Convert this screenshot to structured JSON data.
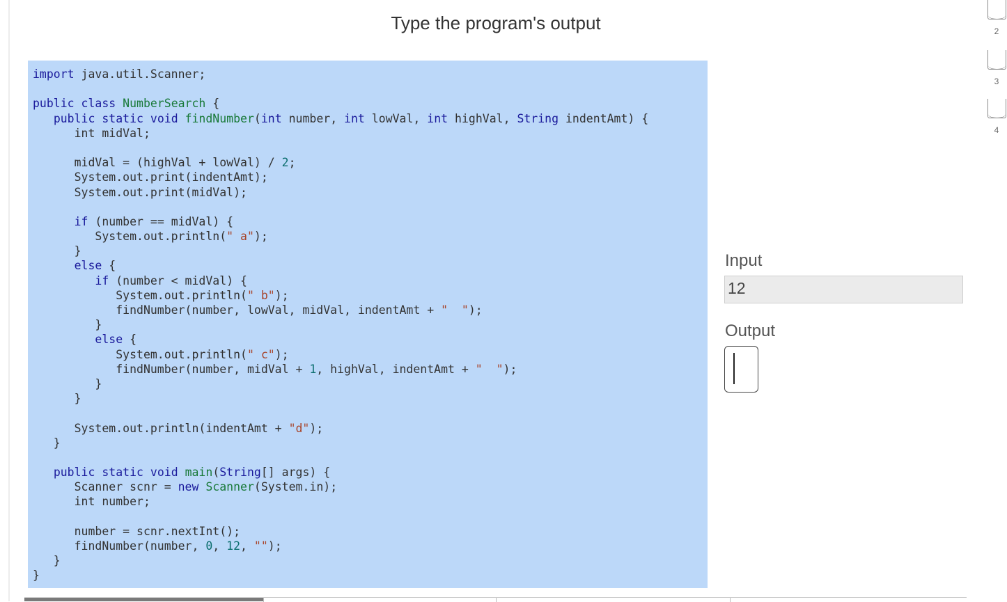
{
  "page": {
    "title": "Type the program's output"
  },
  "code": {
    "lines": [
      [
        {
          "t": "kw",
          "v": "import"
        },
        {
          "t": "",
          "v": " java.util.Scanner;"
        }
      ],
      [],
      [
        {
          "t": "kw",
          "v": "public class"
        },
        {
          "t": "",
          "v": " "
        },
        {
          "t": "cls",
          "v": "NumberSearch"
        },
        {
          "t": "",
          "v": " {"
        }
      ],
      [
        {
          "t": "",
          "v": "   "
        },
        {
          "t": "kw",
          "v": "public static void"
        },
        {
          "t": "",
          "v": " "
        },
        {
          "t": "fn",
          "v": "findNumber"
        },
        {
          "t": "",
          "v": "("
        },
        {
          "t": "kw",
          "v": "int"
        },
        {
          "t": "",
          "v": " number, "
        },
        {
          "t": "kw",
          "v": "int"
        },
        {
          "t": "",
          "v": " lowVal, "
        },
        {
          "t": "kw",
          "v": "int"
        },
        {
          "t": "",
          "v": " highVal, "
        },
        {
          "t": "kw",
          "v": "String"
        },
        {
          "t": "",
          "v": " indentAmt) {"
        }
      ],
      [
        {
          "t": "",
          "v": "      int midVal;"
        }
      ],
      [],
      [
        {
          "t": "",
          "v": "      midVal = (highVal + lowVal) / "
        },
        {
          "t": "num",
          "v": "2"
        },
        {
          "t": "",
          "v": ";"
        }
      ],
      [
        {
          "t": "",
          "v": "      System.out.print(indentAmt);"
        }
      ],
      [
        {
          "t": "",
          "v": "      System.out.print(midVal);"
        }
      ],
      [],
      [
        {
          "t": "",
          "v": "      "
        },
        {
          "t": "kw",
          "v": "if"
        },
        {
          "t": "",
          "v": " (number == midVal) {"
        }
      ],
      [
        {
          "t": "",
          "v": "         System.out.println("
        },
        {
          "t": "str",
          "v": "\" a\""
        },
        {
          "t": "",
          "v": ");"
        }
      ],
      [
        {
          "t": "",
          "v": "      }"
        }
      ],
      [
        {
          "t": "",
          "v": "      "
        },
        {
          "t": "kw",
          "v": "else"
        },
        {
          "t": "",
          "v": " {"
        }
      ],
      [
        {
          "t": "",
          "v": "         "
        },
        {
          "t": "kw",
          "v": "if"
        },
        {
          "t": "",
          "v": " (number < midVal) {"
        }
      ],
      [
        {
          "t": "",
          "v": "            System.out.println("
        },
        {
          "t": "str",
          "v": "\" b\""
        },
        {
          "t": "",
          "v": ");"
        }
      ],
      [
        {
          "t": "",
          "v": "            findNumber(number, lowVal, midVal, indentAmt + "
        },
        {
          "t": "str",
          "v": "\"  \""
        },
        {
          "t": "",
          "v": ");"
        }
      ],
      [
        {
          "t": "",
          "v": "         }"
        }
      ],
      [
        {
          "t": "",
          "v": "         "
        },
        {
          "t": "kw",
          "v": "else"
        },
        {
          "t": "",
          "v": " {"
        }
      ],
      [
        {
          "t": "",
          "v": "            System.out.println("
        },
        {
          "t": "str",
          "v": "\" c\""
        },
        {
          "t": "",
          "v": ");"
        }
      ],
      [
        {
          "t": "",
          "v": "            findNumber(number, midVal + "
        },
        {
          "t": "num",
          "v": "1"
        },
        {
          "t": "",
          "v": ", highVal, indentAmt + "
        },
        {
          "t": "str",
          "v": "\"  \""
        },
        {
          "t": "",
          "v": ");"
        }
      ],
      [
        {
          "t": "",
          "v": "         }"
        }
      ],
      [
        {
          "t": "",
          "v": "      }"
        }
      ],
      [],
      [
        {
          "t": "",
          "v": "      System.out.println(indentAmt + "
        },
        {
          "t": "str",
          "v": "\"d\""
        },
        {
          "t": "",
          "v": ");"
        }
      ],
      [
        {
          "t": "",
          "v": "   }"
        }
      ],
      [],
      [
        {
          "t": "",
          "v": "   "
        },
        {
          "t": "kw",
          "v": "public static void"
        },
        {
          "t": "",
          "v": " "
        },
        {
          "t": "fn",
          "v": "main"
        },
        {
          "t": "",
          "v": "("
        },
        {
          "t": "kw",
          "v": "String"
        },
        {
          "t": "",
          "v": "[] args) {"
        }
      ],
      [
        {
          "t": "",
          "v": "      Scanner scnr = "
        },
        {
          "t": "kw",
          "v": "new"
        },
        {
          "t": "",
          "v": " "
        },
        {
          "t": "cls",
          "v": "Scanner"
        },
        {
          "t": "",
          "v": "(System.in);"
        }
      ],
      [
        {
          "t": "",
          "v": "      int number;"
        }
      ],
      [],
      [
        {
          "t": "",
          "v": "      number = scnr.nextInt();"
        }
      ],
      [
        {
          "t": "",
          "v": "      findNumber(number, "
        },
        {
          "t": "num",
          "v": "0"
        },
        {
          "t": "",
          "v": ", "
        },
        {
          "t": "num",
          "v": "12"
        },
        {
          "t": "",
          "v": ", "
        },
        {
          "t": "str",
          "v": "\"\""
        },
        {
          "t": "",
          "v": ");"
        }
      ],
      [
        {
          "t": "",
          "v": "   }"
        }
      ],
      [
        {
          "t": "",
          "v": "}"
        }
      ]
    ]
  },
  "io": {
    "input_label": "Input",
    "input_value": "12",
    "output_label": "Output",
    "output_value": ""
  },
  "levels": [
    {
      "label": "2"
    },
    {
      "label": "3"
    },
    {
      "label": "4"
    }
  ],
  "colors": {
    "code_background": "#bcd8f9",
    "keyword": "#1b1b9c",
    "identifier": "#1a7a3a",
    "string": "#a8452b",
    "number": "#0b6e6e"
  }
}
